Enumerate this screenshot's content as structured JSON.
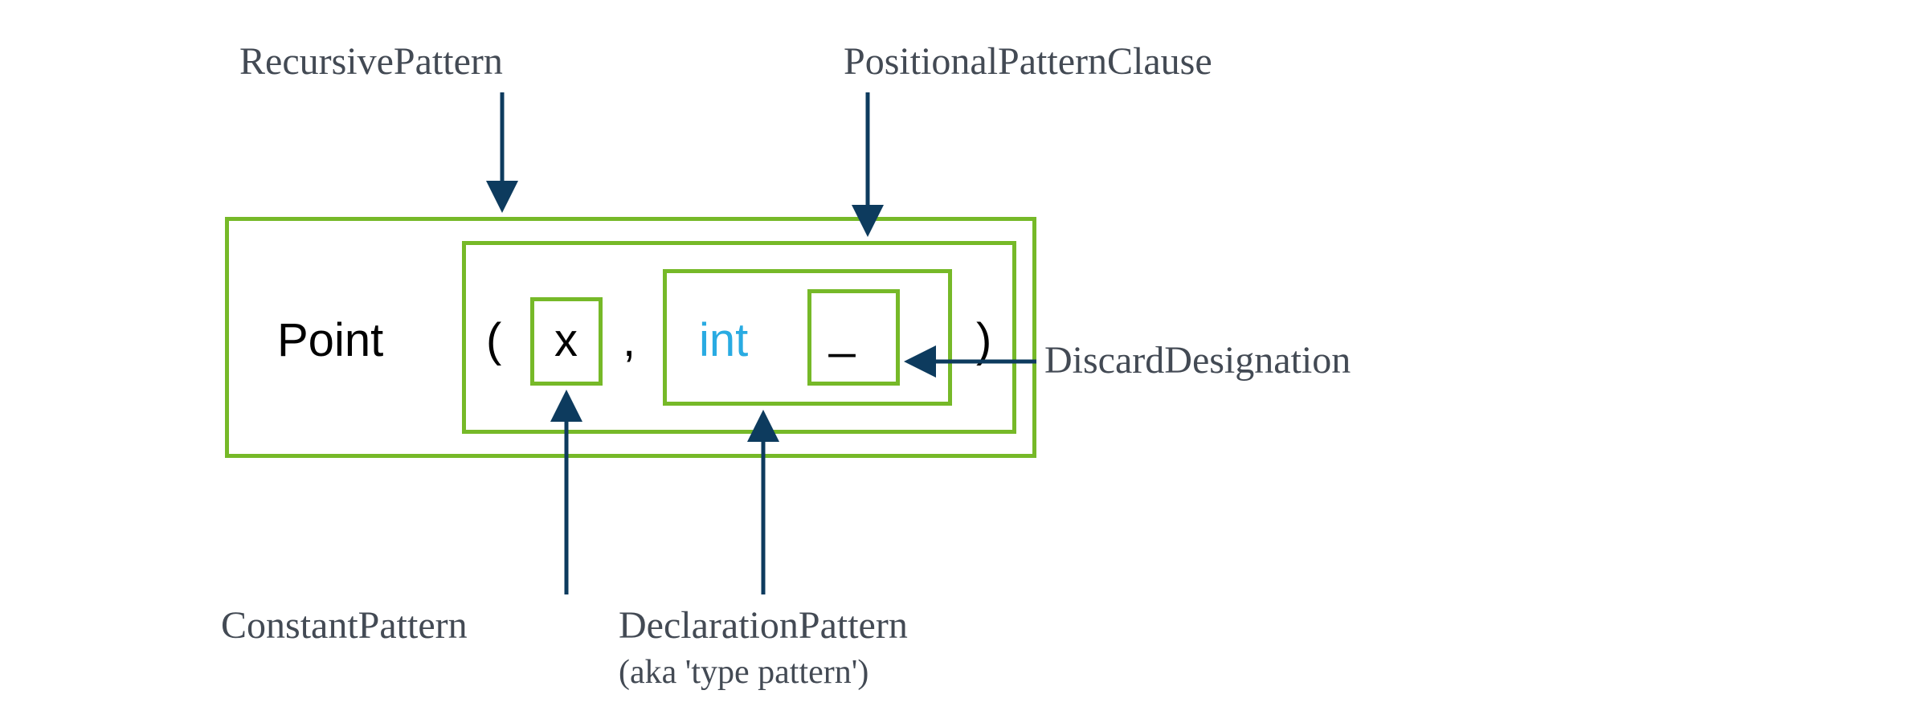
{
  "labels": {
    "recursive": "RecursivePattern",
    "positional": "PositionalPatternClause",
    "discard": "DiscardDesignation",
    "constant": "ConstantPattern",
    "declaration_line1": "DeclarationPattern",
    "declaration_line2": "(aka 'type pattern')"
  },
  "tokens": {
    "point": "Point",
    "lparen": "(",
    "x": "x",
    "comma": ",",
    "int": "int",
    "underscore": "_",
    "rparen": ")"
  },
  "colors": {
    "box_border": "#76b928",
    "arrow": "#0d3b5e",
    "label": "#434a54",
    "keyword": "#29abe2"
  }
}
